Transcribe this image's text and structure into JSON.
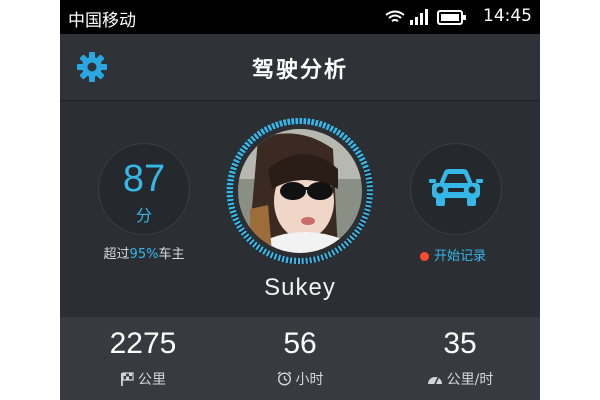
{
  "status_bar": {
    "carrier": "中国移动",
    "time": "14:45"
  },
  "header": {
    "title": "驾驶分析",
    "settings_icon": "gear-icon"
  },
  "score": {
    "value": "87",
    "unit": "分",
    "caption_prefix": "超过",
    "caption_percent": "95%",
    "caption_suffix": "车主"
  },
  "profile": {
    "username": "Sukey"
  },
  "record": {
    "label": "开始记录",
    "icon": "car-icon"
  },
  "stats": [
    {
      "value": "2275",
      "label": "公里",
      "icon": "flag-icon"
    },
    {
      "value": "56",
      "label": "小时",
      "icon": "clock-icon"
    },
    {
      "value": "35",
      "label": "公里/时",
      "icon": "speedometer-icon"
    }
  ],
  "colors": {
    "accent": "#35b7e8",
    "background": "#2b2f34",
    "record_dot": "#ff4b2b"
  }
}
